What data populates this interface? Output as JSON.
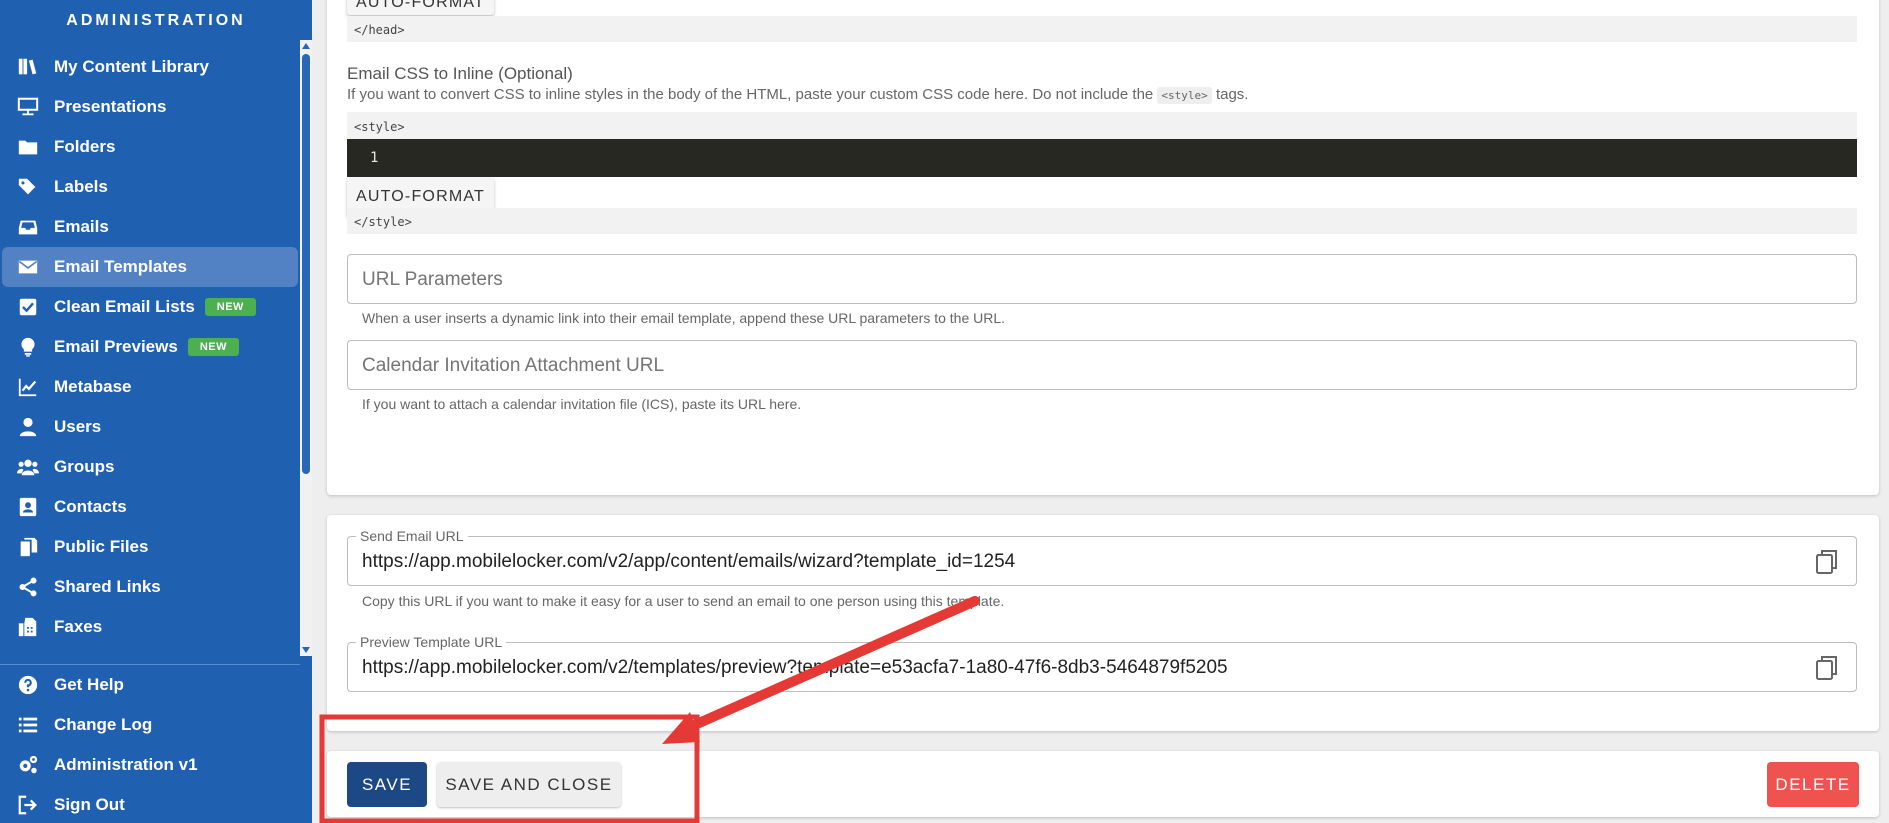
{
  "sidebar": {
    "header": "ADMINISTRATION",
    "items": [
      {
        "label": "My Content Library",
        "icon": "books-icon"
      },
      {
        "label": "Presentations",
        "icon": "presentation-icon"
      },
      {
        "label": "Folders",
        "icon": "folder-icon"
      },
      {
        "label": "Labels",
        "icon": "tags-icon"
      },
      {
        "label": "Emails",
        "icon": "inbox-icon"
      },
      {
        "label": "Email Templates",
        "icon": "envelope-icon",
        "active": true
      },
      {
        "label": "Clean Email Lists",
        "icon": "checkbox-icon",
        "badge": "NEW"
      },
      {
        "label": "Email Previews",
        "icon": "lightbulb-icon",
        "badge": "NEW"
      },
      {
        "label": "Metabase",
        "icon": "chart-line-icon"
      },
      {
        "label": "Users",
        "icon": "user-icon"
      },
      {
        "label": "Groups",
        "icon": "users-icon"
      },
      {
        "label": "Contacts",
        "icon": "contact-card-icon"
      },
      {
        "label": "Public Files",
        "icon": "files-icon"
      },
      {
        "label": "Shared Links",
        "icon": "share-icon"
      },
      {
        "label": "Faxes",
        "icon": "fax-icon"
      }
    ],
    "bottom_items": [
      {
        "label": "Get Help",
        "icon": "question-circle-icon"
      },
      {
        "label": "Change Log",
        "icon": "list-icon"
      },
      {
        "label": "Administration v1",
        "icon": "gears-icon"
      },
      {
        "label": "Sign Out",
        "icon": "sign-out-icon"
      }
    ]
  },
  "head_section": {
    "format_button_top": "AUTO-FORMAT",
    "closing_tag": "</head>"
  },
  "css_section": {
    "title": "Email CSS to Inline (Optional)",
    "desc_before": "If you want to convert CSS to inline styles in the body of the HTML, paste your custom CSS code here. Do not include the",
    "desc_code": "<style>",
    "desc_after": "tags.",
    "opening_tag": "<style>",
    "line_number": "1",
    "format_button": "AUTO-FORMAT",
    "closing_tag": "</style>"
  },
  "url_params": {
    "placeholder": "URL Parameters",
    "hint": "When a user inserts a dynamic link into their email template, append these URL parameters to the URL."
  },
  "calendar": {
    "placeholder": "Calendar Invitation Attachment URL",
    "hint": "If you want to attach a calendar invitation file (ICS), paste its URL here."
  },
  "send_email": {
    "label": "Send Email URL",
    "value": "https://app.mobilelocker.com/v2/app/content/emails/wizard?template_id=1254",
    "hint": "Copy this URL if you want to make it easy for a user to send an email to one person using this template."
  },
  "preview": {
    "label": "Preview Template URL",
    "value": "https://app.mobilelocker.com/v2/templates/preview?template=e53acfa7-1a80-47f6-8db3-5464879f5205"
  },
  "actions": {
    "save": "SAVE",
    "save_close": "SAVE AND CLOSE",
    "delete": "DELETE"
  },
  "annotation": {
    "color": "#e53935"
  }
}
